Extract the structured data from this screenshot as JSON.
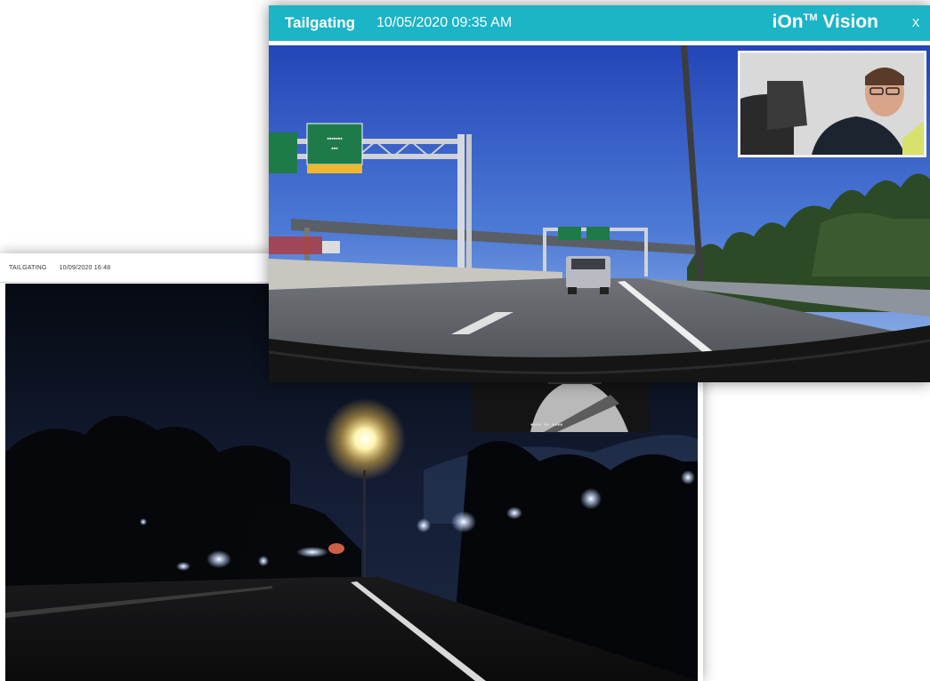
{
  "back_window": {
    "event_label": "TAILGATING",
    "timestamp": "10/09/2020 16:48"
  },
  "front_window": {
    "event_label": "Tailgating",
    "timestamp": "10/05/2020 09:35 AM",
    "brand": "iOn",
    "brand_tm": "TM",
    "brand_suffix": " Vision",
    "close_label": "x"
  },
  "colors": {
    "header_accent": "#1cb4c7",
    "sign_green": "#1f7a4a",
    "night_sky": "#0c111c"
  },
  "icons": {
    "close": "close-icon"
  }
}
